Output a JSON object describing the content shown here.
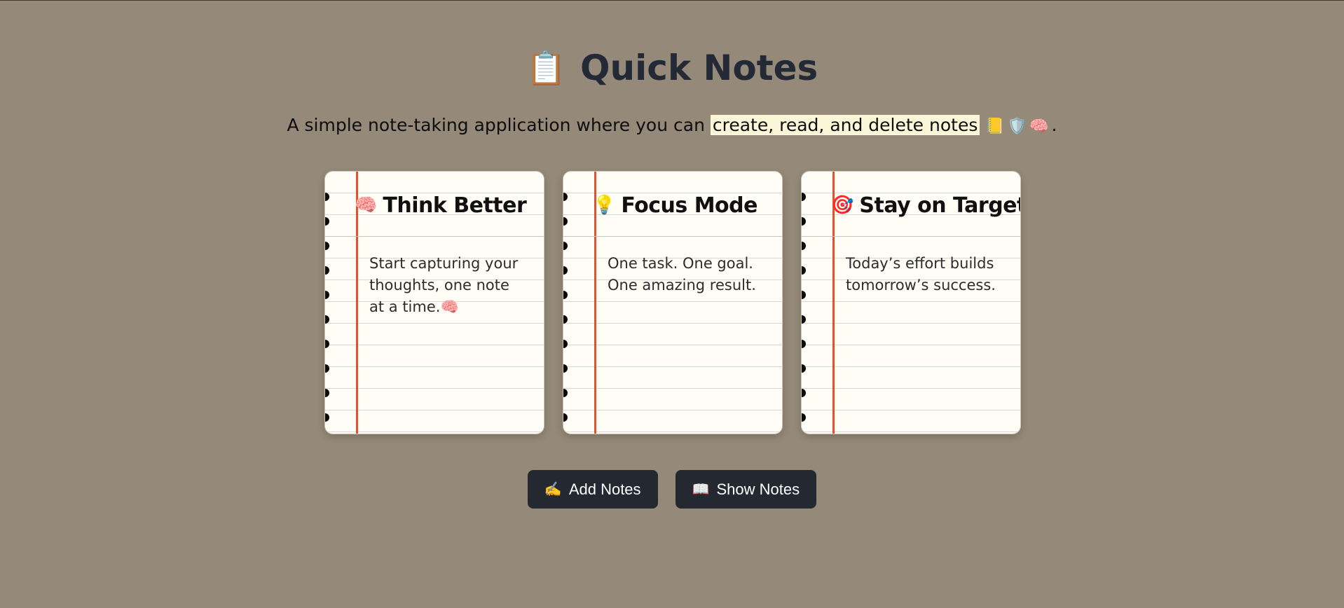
{
  "header": {
    "title": "Quick Notes",
    "title_icon": "📋",
    "title_icon_name": "clipboard-icon"
  },
  "subtitle": {
    "prefix": "A simple note-taking application where you can ",
    "highlight": "create, read, and delete notes",
    "icons": "📒🛡️🧠",
    "suffix": "."
  },
  "cards": [
    {
      "emoji": "🧠",
      "icon_name": "brain-icon",
      "title": "Think Better",
      "body": "Start capturing your thoughts, one note at a time.🧠"
    },
    {
      "emoji": "💡",
      "icon_name": "lightbulb-icon",
      "title": "Focus Mode",
      "body": "One task. One goal. One amazing result."
    },
    {
      "emoji": "🎯",
      "icon_name": "target-icon",
      "title": "Stay on Target",
      "body": "Today’s effort builds tomorrow’s success."
    }
  ],
  "buttons": {
    "add": {
      "icon": "✍️",
      "label": "Add Notes"
    },
    "show": {
      "icon": "📖",
      "label": "Show Notes"
    }
  },
  "colors": {
    "background": "#958979",
    "button": "#232831",
    "margin_line": "#d9562f",
    "card": "#fffdf5",
    "highlight": "#fbf6d7"
  }
}
